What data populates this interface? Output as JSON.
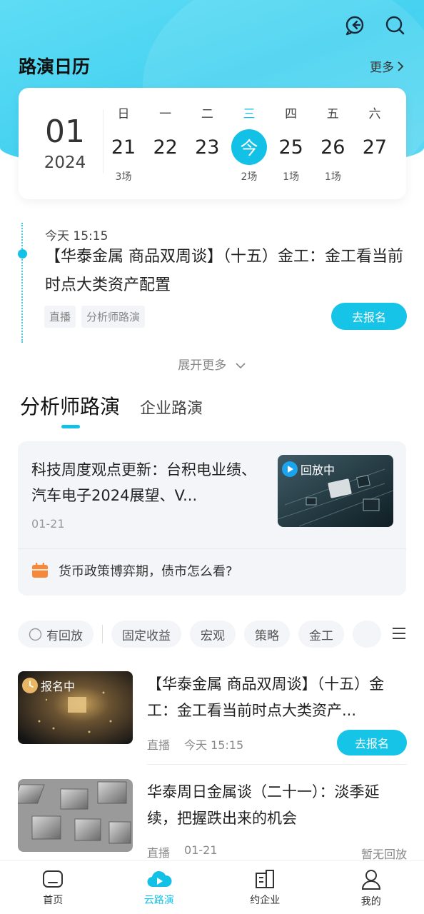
{
  "header": {
    "title": "路演日历",
    "more_label": "更多"
  },
  "calendar": {
    "month": "01",
    "year": "2024",
    "days": [
      {
        "weekday": "日",
        "date": "21",
        "count": "3场"
      },
      {
        "weekday": "一",
        "date": "22",
        "count": ""
      },
      {
        "weekday": "二",
        "date": "23",
        "count": ""
      },
      {
        "weekday": "三",
        "date": "今",
        "count": "2场"
      },
      {
        "weekday": "四",
        "date": "25",
        "count": "1场"
      },
      {
        "weekday": "五",
        "date": "26",
        "count": "1场"
      },
      {
        "weekday": "六",
        "date": "27",
        "count": ""
      }
    ]
  },
  "event": {
    "time": "今天 15:15",
    "title": "【华泰金属 商品双周谈】（十五）金工：金工看当前时点大类资产配置",
    "tags": [
      "直播",
      "分析师路演"
    ],
    "button": "去报名",
    "expand": "展开更多"
  },
  "tabs": {
    "active": "分析师路演",
    "other": "企业路演"
  },
  "featured": {
    "title": "科技周度观点更新：台积电业绩、汽车电子2024展望、V...",
    "date": "01-21",
    "badge": "回放中",
    "sub_text": "货币政策博弈期，债市怎么看?"
  },
  "filters": {
    "replay": "有回放",
    "chips": [
      "固定收益",
      "宏观",
      "策略",
      "金工"
    ]
  },
  "list": [
    {
      "badge": "报名中",
      "title": "【华泰金属 商品双周谈】（十五）金工：金工看当前时点大类资产...",
      "type": "直播",
      "time": "今天 15:15",
      "button": "去报名"
    },
    {
      "title": "华泰周日金属谈（二十一）：淡季延续，把握跌出来的机会",
      "type": "直播",
      "time": "01-21",
      "status": "暂无回放"
    }
  ],
  "nav": [
    {
      "label": "首页",
      "icon": "home-icon"
    },
    {
      "label": "云路演",
      "icon": "cloud-play-icon"
    },
    {
      "label": "约企业",
      "icon": "building-icon"
    },
    {
      "label": "我的",
      "icon": "user-icon"
    }
  ],
  "colors": {
    "accent": "#14c1e6",
    "orange": "#f5883a"
  }
}
